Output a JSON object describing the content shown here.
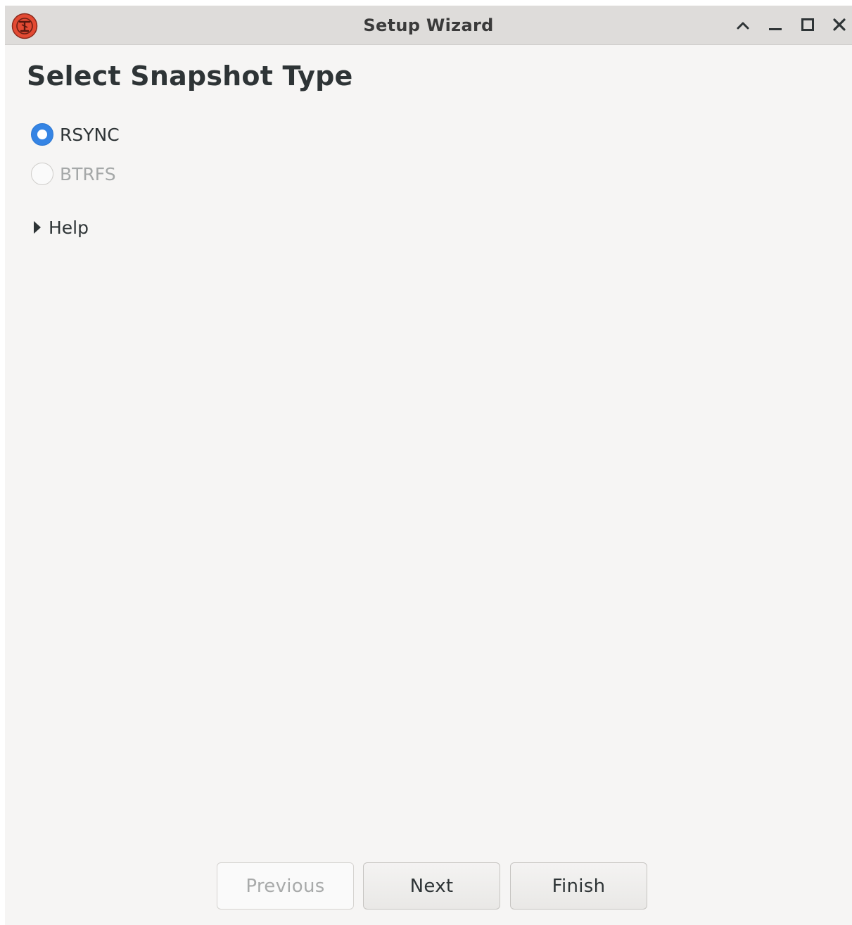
{
  "window": {
    "title": "Setup Wizard",
    "controls": {
      "shade_icon": "chevron-up-icon",
      "minimize_icon": "minimize-icon",
      "maximize_icon": "maximize-icon",
      "close_icon": "close-icon"
    },
    "app_icon": "timeshift-app-icon"
  },
  "page": {
    "heading": "Select Snapshot Type",
    "options": [
      {
        "label": "RSYNC",
        "selected": true,
        "enabled": true
      },
      {
        "label": "BTRFS",
        "selected": false,
        "enabled": false
      }
    ],
    "help_expander": {
      "label": "Help",
      "expanded": false
    }
  },
  "footer": {
    "previous_label": "Previous",
    "next_label": "Next",
    "finish_label": "Finish"
  },
  "colors": {
    "accent": "#3584e4",
    "app_icon": "#e34a33"
  }
}
